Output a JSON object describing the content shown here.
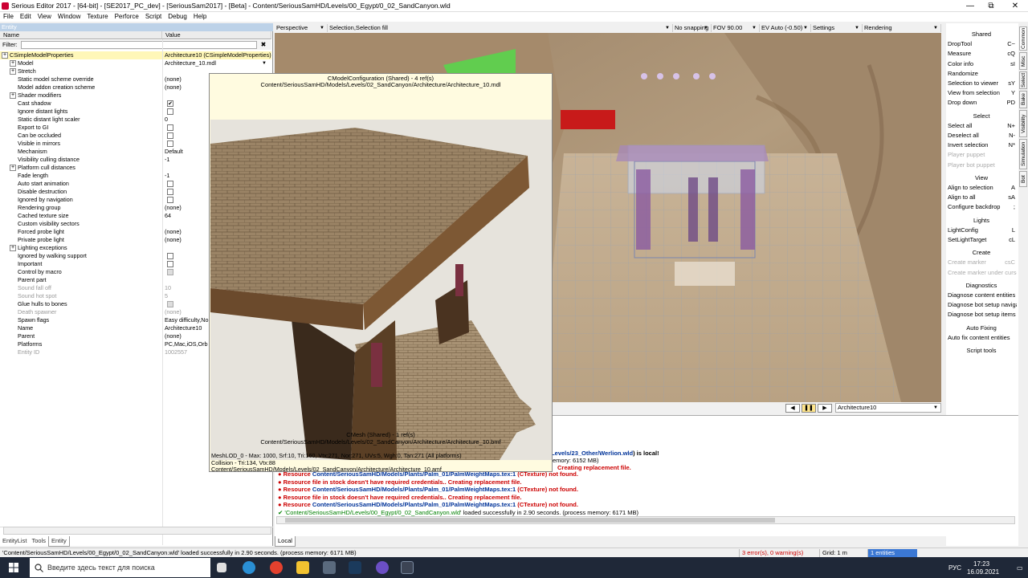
{
  "window": {
    "title": "Serious Editor 2017 - [64-bit] - [SE2017_PC_dev] - [SeriousSam2017] - [Beta] - Content/SeriousSamHD/Levels/00_Egypt/0_02_SandCanyon.wld",
    "minimize": "—",
    "restore": "⧉",
    "close": "✕"
  },
  "menu": [
    "File",
    "Edit",
    "View",
    "Window",
    "Texture",
    "Perforce",
    "Script",
    "Debug",
    "Help"
  ],
  "left": {
    "panel_title": "Entity",
    "col_name": "Name",
    "col_value": "Value",
    "filter_label": "Filter:",
    "filter_value": "",
    "filter_clear": "✖",
    "rows": [
      {
        "n": "CSimpleModelProperties",
        "v": "Architecture10 (CSimpleModelProperties)",
        "t": "sec",
        "hl": true
      },
      {
        "n": "Model",
        "v": "Architecture_10.mdl",
        "t": "exp",
        "dd": true
      },
      {
        "n": "Stretch",
        "v": "",
        "t": "exp"
      },
      {
        "n": "Static model scheme override",
        "v": "(none)",
        "t": "p"
      },
      {
        "n": "Model addon creation scheme",
        "v": "(none)",
        "t": "p"
      },
      {
        "n": "Shader modifiers",
        "v": "",
        "t": "exp"
      },
      {
        "n": "Cast shadow",
        "v": "",
        "t": "cb",
        "c": true
      },
      {
        "n": "Ignore distant lights",
        "v": "",
        "t": "cb"
      },
      {
        "n": "Static distant light scaler",
        "v": "0",
        "t": "p"
      },
      {
        "n": "Export to GI",
        "v": "",
        "t": "cb"
      },
      {
        "n": "Can be occluded",
        "v": "",
        "t": "cb"
      },
      {
        "n": "Visible in mirrors",
        "v": "",
        "t": "cb"
      },
      {
        "n": "Mechanism",
        "v": "Default",
        "t": "p"
      },
      {
        "n": "Visibility culling distance",
        "v": "-1",
        "t": "p"
      },
      {
        "n": "Platform cull distances",
        "v": "",
        "t": "exp"
      },
      {
        "n": "Fade length",
        "v": "-1",
        "t": "p"
      },
      {
        "n": "Auto start animation",
        "v": "",
        "t": "cb"
      },
      {
        "n": "Disable destruction",
        "v": "",
        "t": "cb"
      },
      {
        "n": "Ignored by navigation",
        "v": "",
        "t": "cb"
      },
      {
        "n": "Rendering group",
        "v": "(none)",
        "t": "p"
      },
      {
        "n": "Cached texture size",
        "v": "64",
        "t": "p"
      },
      {
        "n": "Custom visibility sectors",
        "v": "",
        "t": "p"
      },
      {
        "n": "Forced probe light",
        "v": "(none)",
        "t": "p"
      },
      {
        "n": "Private probe light",
        "v": "(none)",
        "t": "p"
      },
      {
        "n": "Lighting exceptions",
        "v": "",
        "t": "exp"
      },
      {
        "n": "Ignored by walking support",
        "v": "",
        "t": "cb"
      },
      {
        "n": "Important",
        "v": "",
        "t": "cb"
      },
      {
        "n": "Control by macro",
        "v": "",
        "t": "cbd"
      },
      {
        "n": "Parent part",
        "v": "",
        "t": "p"
      },
      {
        "n": "Sound fall off",
        "v": "10",
        "t": "p",
        "g": true
      },
      {
        "n": "Sound hot spot",
        "v": "5",
        "t": "p",
        "g": true
      },
      {
        "n": "Glue hulls to bones",
        "v": "",
        "t": "cbd"
      },
      {
        "n": "Death spawner",
        "v": "(none)",
        "t": "p",
        "g": true
      },
      {
        "n": "Spawn flags",
        "v": "Easy difficulty,Nor",
        "t": "p"
      },
      {
        "n": "Name",
        "v": "Architecture10",
        "t": "p"
      },
      {
        "n": "Parent",
        "v": "(none)",
        "t": "p"
      },
      {
        "n": "Platforms",
        "v": "PC,Mac,iOS,Orb",
        "t": "p"
      },
      {
        "n": "Entity ID",
        "v": "1002557",
        "t": "p",
        "g": true
      }
    ],
    "tabs": [
      "EntityList",
      "Tools",
      "Entity"
    ]
  },
  "viewport": {
    "mode": "Perspective",
    "selection": "Selection,Selection fill",
    "snapping": "No snapping",
    "fov": "FOV 90.00",
    "ev": "EV Auto (-0.50)",
    "settings": "Settings",
    "rendering": "Rendering",
    "play_prev": "◀",
    "pause": "❚❚",
    "play_next": "▶",
    "selected_entity": "Architecture10"
  },
  "popup": {
    "header1": "CModelConfiguration (Shared) - 4 ref(s)",
    "header2": "Content/SeriousSamHD/Models/Levels/02_SandCanyon/Architecture/Architecture_10.mdl",
    "mesh1": "CMesh (Shared) - 1 ref(s)",
    "mesh2": "Content/SeriousSamHD/Models/Levels/02_SandCanyon/Architecture/Architecture_10.bmf",
    "info1": "MeshLOD_0 - Max: 1000, Srf:10, Tri:160, Vtx:271, Nor:271, UVs:5, Wgh:0, Tan:271 (All platforms)",
    "info2": "Collision - Tri:134, Vtx:88",
    "info3": "Content/SeriousSamHD/Models/Levels/02_SandCanyon/Architecture/Architecture_10.amf"
  },
  "right": {
    "items": [
      {
        "t": "h",
        "l": "Shared"
      },
      {
        "l": "DropTool",
        "k": "C~"
      },
      {
        "l": "Measure",
        "k": "cQ"
      },
      {
        "l": "Color info",
        "k": "sI"
      },
      {
        "l": "Randomize",
        "k": ""
      },
      {
        "l": "Selection to viewer",
        "k": "sY"
      },
      {
        "l": "View from selection",
        "k": "Y"
      },
      {
        "l": "Drop down",
        "k": "PD"
      },
      {
        "t": "h",
        "l": "Select"
      },
      {
        "l": "Select all",
        "k": "N+"
      },
      {
        "l": "Deselect all",
        "k": "N-"
      },
      {
        "l": "Invert selection",
        "k": "N*"
      },
      {
        "l": "Player puppet",
        "k": "",
        "d": true
      },
      {
        "l": "Player bot puppet",
        "k": "",
        "d": true
      },
      {
        "t": "h",
        "l": "View"
      },
      {
        "l": "Align to selection",
        "k": "A"
      },
      {
        "l": "Align to all",
        "k": "sA"
      },
      {
        "l": "Configure backdrop",
        "k": ";"
      },
      {
        "t": "h",
        "l": "Lights"
      },
      {
        "l": "LightConfig",
        "k": "L"
      },
      {
        "l": "SetLightTarget",
        "k": "cL"
      },
      {
        "t": "h",
        "l": "Create"
      },
      {
        "l": "Create marker",
        "k": "csC",
        "d": true
      },
      {
        "l": "Create marker under cursor",
        "k": "",
        "d": true
      },
      {
        "t": "h",
        "l": "Diagnostics"
      },
      {
        "l": "Diagnose content entities",
        "k": ""
      },
      {
        "l": "Diagnose bot setup navigation",
        "k": ""
      },
      {
        "l": "Diagnose bot setup items",
        "k": ""
      },
      {
        "t": "h",
        "l": "Auto Fixing"
      },
      {
        "l": "Auto fix content entities",
        "k": ""
      },
      {
        "t": "h",
        "l": "Script tools"
      }
    ],
    "sidetabs": [
      "Common",
      "Misc",
      "Select",
      "Bake",
      "Visibility",
      "Simulation",
      "Bot"
    ]
  },
  "console": {
    "frag1_a": "/Levels/23_Other/Werlion.wld",
    "frag1_b": ") is local!",
    "frag2": "emory: 6152 MB)",
    "frag3": "Creating replacement file.",
    "lines": [
      {
        "a": "Resource ",
        "b": "Content/SeriousSamHD/Models/Plants/Palm_01/PalmWeightMaps.tex:1",
        "c": " (CTexture) not found."
      },
      {
        "a": "Resource file in stock doesn't have required credentials.. Creating replacement file.",
        "b": "",
        "c": ""
      },
      {
        "a": "Resource ",
        "b": "Content/SeriousSamHD/Models/Plants/Palm_01/PalmWeightMaps.tex:1",
        "c": " (CTexture) not found."
      },
      {
        "a": "Resource file in stock doesn't have required credentials.. Creating replacement file.",
        "b": "",
        "c": ""
      },
      {
        "a": "Resource ",
        "b": "Content/SeriousSamHD/Models/Plants/Palm_01/PalmWeightMaps.tex:1",
        "c": " (CTexture) not found."
      }
    ],
    "ok_path": "'Content/SeriousSamHD/Levels/00_Egypt/0_02_SandCanyon.wld",
    "ok_rest": "' loaded successfully in 2.90 seconds. (process memory: 6171 MB)",
    "tab": "Local"
  },
  "status": {
    "msg": "'Content/SeriousSamHD/Levels/00_Egypt/0_02_SandCanyon.wld' loaded successfully in 2.90 seconds. (process memory: 6171 MB)",
    "errors": "3 error(s), 0 warning(s)",
    "grid": "Grid: 1 m",
    "entities": "1 entities"
  },
  "taskbar": {
    "search": "Введите здесь текст для поиска",
    "lang": "РУС",
    "time": "17:23",
    "date": "16.09.2021"
  }
}
